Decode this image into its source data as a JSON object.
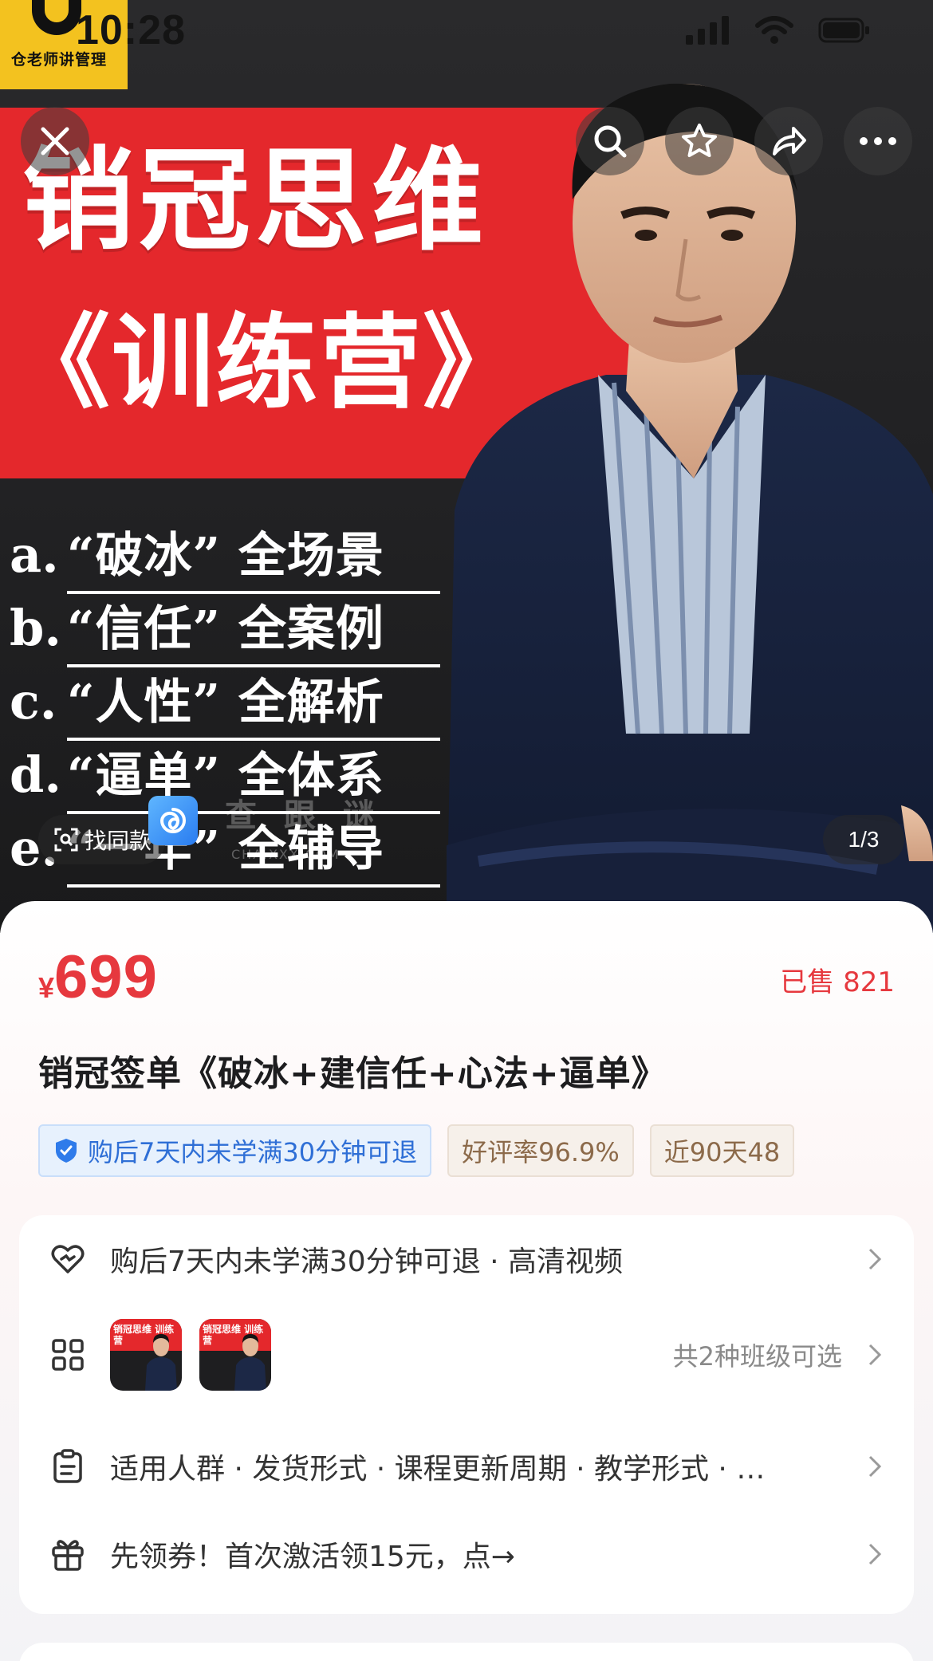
{
  "status_bar": {
    "time": "10:28"
  },
  "brand": {
    "name": "仓老师讲管理"
  },
  "hero": {
    "title": "销冠思维",
    "subtitle": "《训练营》",
    "bullets": [
      {
        "letter": "a.",
        "text": "“破冰” 全场景"
      },
      {
        "letter": "b.",
        "text": "“信任” 全案例"
      },
      {
        "letter": "c.",
        "text": "“人性” 全解析"
      },
      {
        "letter": "d.",
        "text": "“逼单” 全体系"
      },
      {
        "letter": "e.",
        "text": "“一年” 全辅导"
      }
    ],
    "watermark": "查 跟 谜",
    "watermark_sub": "CHA.XXX.COM",
    "find_similar_label": "找同款",
    "page_indicator": "1/3"
  },
  "product": {
    "currency": "¥",
    "price": "699",
    "sold": "已售 821",
    "title": "销冠签单《破冰+建信任+心法+逼单》",
    "tags": [
      {
        "type": "refund",
        "label": "购后7天内未学满30分钟可退"
      },
      {
        "type": "rating",
        "label": "好评率96.9%"
      },
      {
        "type": "recent",
        "label": "近90天48"
      }
    ]
  },
  "details": {
    "guarantee": "购后7天内未学满30分钟可退 · 高清视频",
    "thumb_text": "销冠思维 训练营",
    "class_options": "共2种班级可选",
    "attributes": "适用人群 · 发货形式 · 课程更新周期 · 教学形式 · …",
    "coupon": "先领券！首次激活领15元，点→"
  },
  "colors": {
    "accent": "#e6383e",
    "hero_red": "#e4282c",
    "refund_blue": "#2f6fd6",
    "tag_brown": "#8c6a4a"
  },
  "icons": {
    "close": "close-icon",
    "search": "search-icon",
    "favorite": "star-icon",
    "share": "share-icon",
    "more": "more-icon",
    "guarantee": "heart-shield-icon",
    "classes": "grid-icon",
    "attributes": "clipboard-icon",
    "coupon": "gift-icon"
  }
}
